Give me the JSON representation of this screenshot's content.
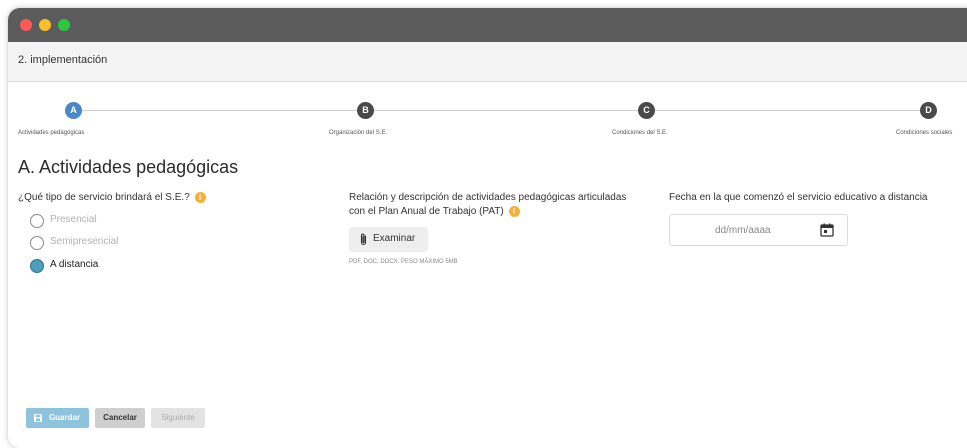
{
  "header": {
    "title": "2. implementación"
  },
  "stepper": {
    "steps": [
      {
        "letter": "A",
        "label": "Actividades pedagógicas",
        "active": true
      },
      {
        "letter": "B",
        "label": "Organización del S.E.",
        "active": false
      },
      {
        "letter": "C",
        "label": "Condiciones del S.E.",
        "active": false
      },
      {
        "letter": "D",
        "label": "Condiciones sociales",
        "active": false
      }
    ]
  },
  "section": {
    "title": "A. Actividades pedagógicas"
  },
  "service_type": {
    "question": "¿Qué tipo de servicio brindará el S.E.?",
    "options": [
      {
        "label": "Presencial",
        "checked": false,
        "disabled": true
      },
      {
        "label": "Semipresencial",
        "checked": false,
        "disabled": true
      },
      {
        "label": "A distancia",
        "checked": true,
        "disabled": false
      }
    ]
  },
  "upload": {
    "label_line1": "Relación y descripción de actividades pedagógicas articuladas",
    "label_line2": "con el Plan Anual de Trabajo (PAT)",
    "button_label": "Examinar",
    "hint": "PDF, DOC, DOCX. PESO MÁXIMO 5MB"
  },
  "start_date": {
    "label": "Fecha en la que comenzó el servicio educativo a distancia",
    "placeholder": "dd/mm/aaaa"
  },
  "actions": {
    "save_label": "Guardar",
    "cancel_label": "Cancelar",
    "next_label": "Siguiente"
  },
  "icons": {
    "info": "info-icon",
    "clip": "paperclip-icon",
    "calendar": "calendar-icon",
    "save": "floppy-disk-icon"
  },
  "colors": {
    "accent": "#4b86c8",
    "radio_checked": "#4e9dbd",
    "info": "#f3b13a",
    "save_button": "#8ec3de"
  }
}
